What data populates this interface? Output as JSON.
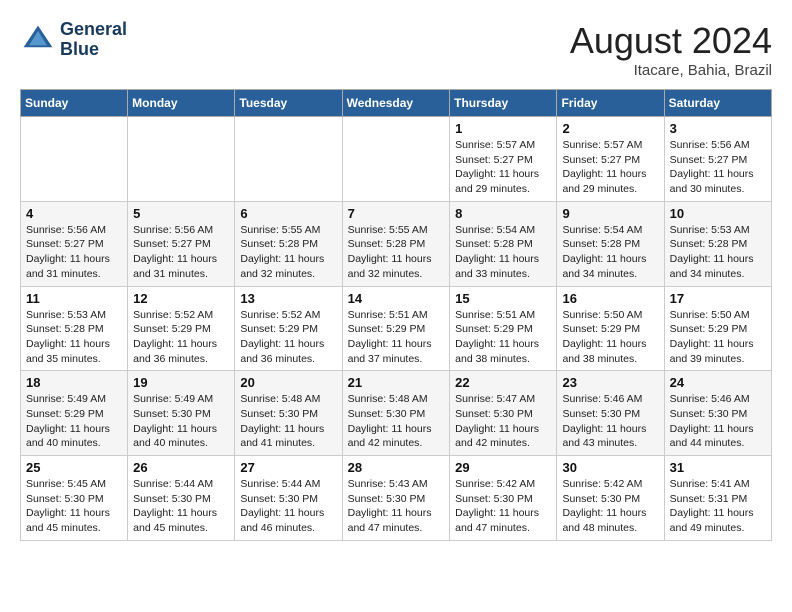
{
  "header": {
    "logo_line1": "General",
    "logo_line2": "Blue",
    "month": "August 2024",
    "location": "Itacare, Bahia, Brazil"
  },
  "weekdays": [
    "Sunday",
    "Monday",
    "Tuesday",
    "Wednesday",
    "Thursday",
    "Friday",
    "Saturday"
  ],
  "weeks": [
    [
      {
        "day": "",
        "info": ""
      },
      {
        "day": "",
        "info": ""
      },
      {
        "day": "",
        "info": ""
      },
      {
        "day": "",
        "info": ""
      },
      {
        "day": "1",
        "info": "Sunrise: 5:57 AM\nSunset: 5:27 PM\nDaylight: 11 hours\nand 29 minutes."
      },
      {
        "day": "2",
        "info": "Sunrise: 5:57 AM\nSunset: 5:27 PM\nDaylight: 11 hours\nand 29 minutes."
      },
      {
        "day": "3",
        "info": "Sunrise: 5:56 AM\nSunset: 5:27 PM\nDaylight: 11 hours\nand 30 minutes."
      }
    ],
    [
      {
        "day": "4",
        "info": "Sunrise: 5:56 AM\nSunset: 5:27 PM\nDaylight: 11 hours\nand 31 minutes."
      },
      {
        "day": "5",
        "info": "Sunrise: 5:56 AM\nSunset: 5:27 PM\nDaylight: 11 hours\nand 31 minutes."
      },
      {
        "day": "6",
        "info": "Sunrise: 5:55 AM\nSunset: 5:28 PM\nDaylight: 11 hours\nand 32 minutes."
      },
      {
        "day": "7",
        "info": "Sunrise: 5:55 AM\nSunset: 5:28 PM\nDaylight: 11 hours\nand 32 minutes."
      },
      {
        "day": "8",
        "info": "Sunrise: 5:54 AM\nSunset: 5:28 PM\nDaylight: 11 hours\nand 33 minutes."
      },
      {
        "day": "9",
        "info": "Sunrise: 5:54 AM\nSunset: 5:28 PM\nDaylight: 11 hours\nand 34 minutes."
      },
      {
        "day": "10",
        "info": "Sunrise: 5:53 AM\nSunset: 5:28 PM\nDaylight: 11 hours\nand 34 minutes."
      }
    ],
    [
      {
        "day": "11",
        "info": "Sunrise: 5:53 AM\nSunset: 5:28 PM\nDaylight: 11 hours\nand 35 minutes."
      },
      {
        "day": "12",
        "info": "Sunrise: 5:52 AM\nSunset: 5:29 PM\nDaylight: 11 hours\nand 36 minutes."
      },
      {
        "day": "13",
        "info": "Sunrise: 5:52 AM\nSunset: 5:29 PM\nDaylight: 11 hours\nand 36 minutes."
      },
      {
        "day": "14",
        "info": "Sunrise: 5:51 AM\nSunset: 5:29 PM\nDaylight: 11 hours\nand 37 minutes."
      },
      {
        "day": "15",
        "info": "Sunrise: 5:51 AM\nSunset: 5:29 PM\nDaylight: 11 hours\nand 38 minutes."
      },
      {
        "day": "16",
        "info": "Sunrise: 5:50 AM\nSunset: 5:29 PM\nDaylight: 11 hours\nand 38 minutes."
      },
      {
        "day": "17",
        "info": "Sunrise: 5:50 AM\nSunset: 5:29 PM\nDaylight: 11 hours\nand 39 minutes."
      }
    ],
    [
      {
        "day": "18",
        "info": "Sunrise: 5:49 AM\nSunset: 5:29 PM\nDaylight: 11 hours\nand 40 minutes."
      },
      {
        "day": "19",
        "info": "Sunrise: 5:49 AM\nSunset: 5:30 PM\nDaylight: 11 hours\nand 40 minutes."
      },
      {
        "day": "20",
        "info": "Sunrise: 5:48 AM\nSunset: 5:30 PM\nDaylight: 11 hours\nand 41 minutes."
      },
      {
        "day": "21",
        "info": "Sunrise: 5:48 AM\nSunset: 5:30 PM\nDaylight: 11 hours\nand 42 minutes."
      },
      {
        "day": "22",
        "info": "Sunrise: 5:47 AM\nSunset: 5:30 PM\nDaylight: 11 hours\nand 42 minutes."
      },
      {
        "day": "23",
        "info": "Sunrise: 5:46 AM\nSunset: 5:30 PM\nDaylight: 11 hours\nand 43 minutes."
      },
      {
        "day": "24",
        "info": "Sunrise: 5:46 AM\nSunset: 5:30 PM\nDaylight: 11 hours\nand 44 minutes."
      }
    ],
    [
      {
        "day": "25",
        "info": "Sunrise: 5:45 AM\nSunset: 5:30 PM\nDaylight: 11 hours\nand 45 minutes."
      },
      {
        "day": "26",
        "info": "Sunrise: 5:44 AM\nSunset: 5:30 PM\nDaylight: 11 hours\nand 45 minutes."
      },
      {
        "day": "27",
        "info": "Sunrise: 5:44 AM\nSunset: 5:30 PM\nDaylight: 11 hours\nand 46 minutes."
      },
      {
        "day": "28",
        "info": "Sunrise: 5:43 AM\nSunset: 5:30 PM\nDaylight: 11 hours\nand 47 minutes."
      },
      {
        "day": "29",
        "info": "Sunrise: 5:42 AM\nSunset: 5:30 PM\nDaylight: 11 hours\nand 47 minutes."
      },
      {
        "day": "30",
        "info": "Sunrise: 5:42 AM\nSunset: 5:30 PM\nDaylight: 11 hours\nand 48 minutes."
      },
      {
        "day": "31",
        "info": "Sunrise: 5:41 AM\nSunset: 5:31 PM\nDaylight: 11 hours\nand 49 minutes."
      }
    ]
  ]
}
